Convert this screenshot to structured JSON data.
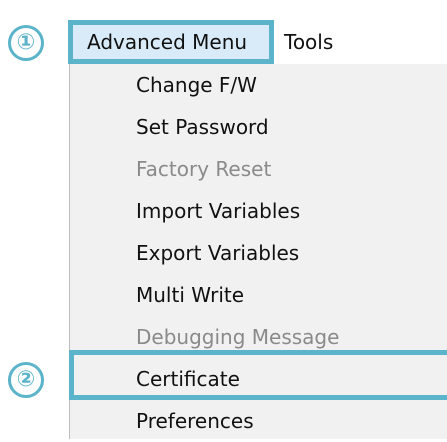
{
  "steps": {
    "first": "①",
    "second": "②"
  },
  "menubar": {
    "items": [
      {
        "label": "Advanced Menu"
      },
      {
        "label": "Tools"
      }
    ]
  },
  "dropdown": {
    "items": [
      {
        "label": "Change F/W",
        "enabled": true
      },
      {
        "label": "Set Password",
        "enabled": true
      },
      {
        "label": "Factory Reset",
        "enabled": false
      },
      {
        "label": "Import Variables",
        "enabled": true
      },
      {
        "label": "Export Variables",
        "enabled": true
      },
      {
        "label": "Multi Write",
        "enabled": true
      },
      {
        "label": "Debugging Message",
        "enabled": false
      },
      {
        "label": "Certificate",
        "enabled": true
      },
      {
        "label": "Preferences",
        "enabled": true
      }
    ]
  },
  "colors": {
    "callout": "#5bb4c9",
    "selected_background": "#d9ebf8",
    "dropdown_background": "#f1f1f1",
    "disabled_text": "#8a8a8a"
  }
}
